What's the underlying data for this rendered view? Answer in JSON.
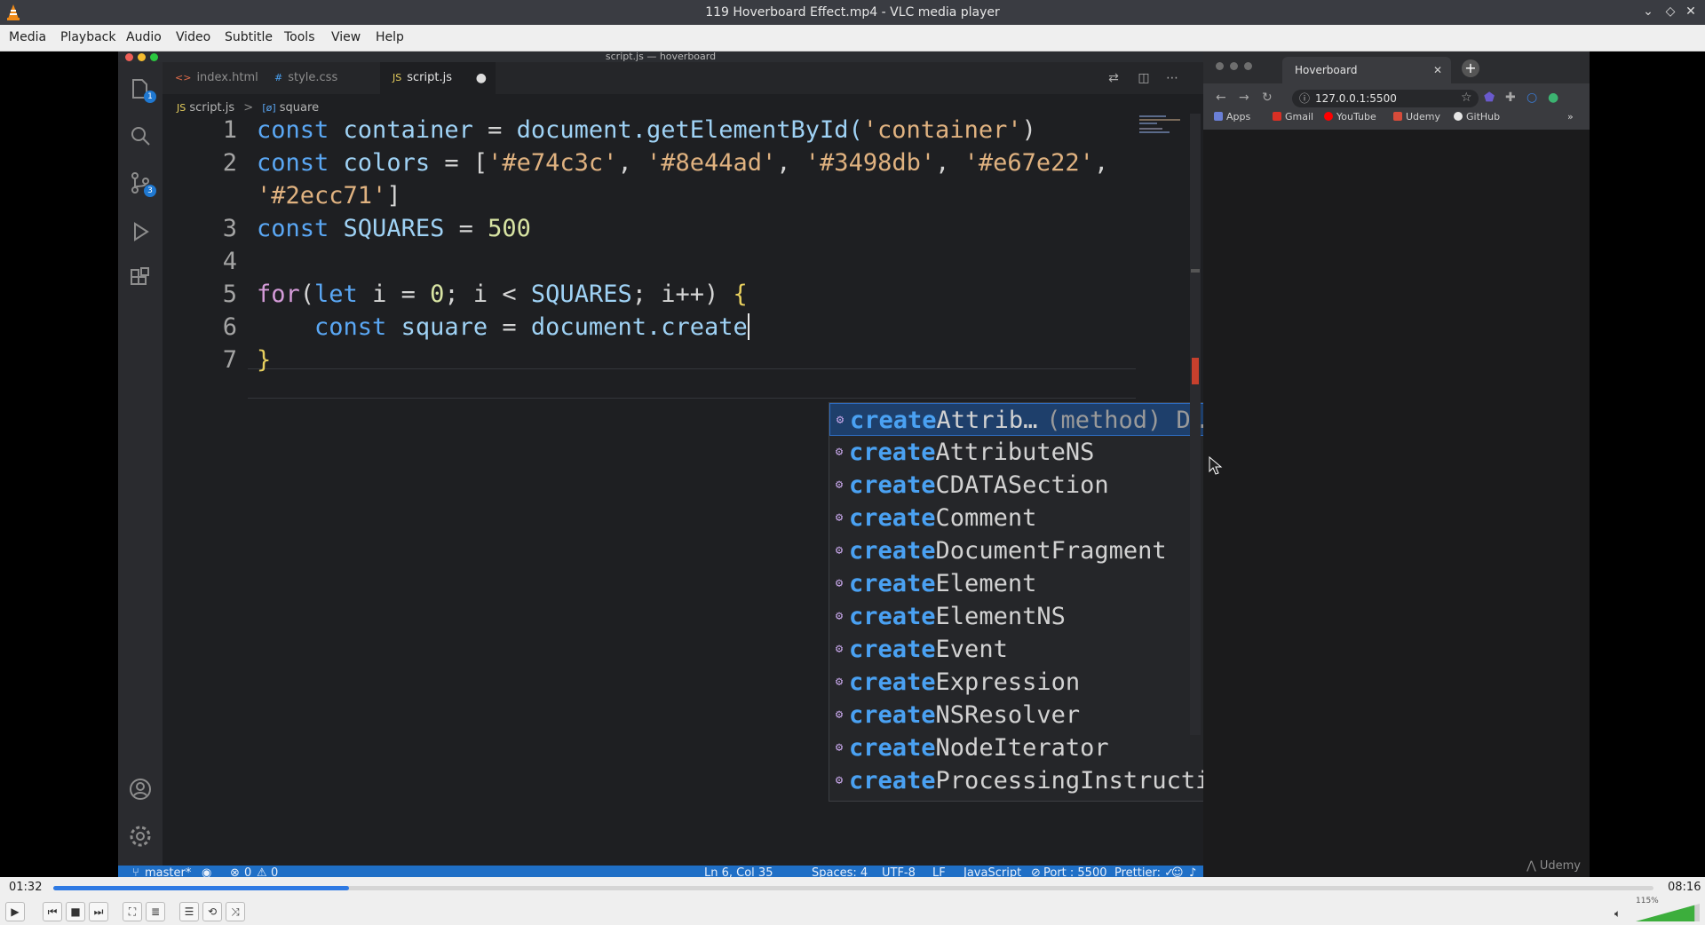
{
  "window": {
    "title": "119 Hoverboard Effect.mp4 - VLC media player",
    "buttons": [
      "chevron-down",
      "restore",
      "close"
    ]
  },
  "menu": [
    "Media",
    "Playback",
    "Audio",
    "Video",
    "Subtitle",
    "Tools",
    "View",
    "Help"
  ],
  "vscode": {
    "title": "script.js — hoverboard",
    "tabs": [
      {
        "tag": "<>",
        "label": "index.html"
      },
      {
        "tag": "#",
        "label": "style.css"
      },
      {
        "tag": "JS",
        "label": "script.js"
      }
    ],
    "breadcrumb": {
      "file": "script.js",
      "symbol": "square",
      "file_tag": "JS",
      "symbol_tag": "[ø]"
    },
    "activity_badges": {
      "explorer": "1",
      "scm": "3"
    },
    "line_numbers": [
      "1",
      "2",
      "",
      "3",
      "4",
      "5",
      "6",
      "7"
    ],
    "code": {
      "l1": {
        "kw": "const",
        "name": "container",
        "eq": " = ",
        "obj": "document.getElementById(",
        "arg": "'container'",
        "close": ")"
      },
      "l2": {
        "kw": "const",
        "name": "colors",
        "eq": " = ",
        "open": "[",
        "c1": "'#e74c3c'",
        "c2": "'#8e44ad'",
        "c3": "'#3498db'",
        "c4": "'#e67e22'",
        "comma": ", "
      },
      "l2b": {
        "c5": "'#2ecc71'",
        "close": "]"
      },
      "l3": {
        "kw": "const",
        "name": "SQUARES",
        "eq": " = ",
        "num": "500"
      },
      "l5": {
        "kw": "for",
        "open": "(",
        "let": "let",
        "body": " i = ",
        "zero": "0",
        "mid": "; i < ",
        "name": "SQUARES",
        "end": "; i++) ",
        "brace": "{"
      },
      "l6": {
        "kw": "const",
        "name": "square",
        "eq": " = ",
        "call": "document.create"
      },
      "l7": {
        "brace": "}"
      }
    },
    "suggestions": [
      {
        "match": "create",
        "rest": "Attrib…",
        "detail": "(method) D…"
      },
      {
        "match": "create",
        "rest": "AttributeNS"
      },
      {
        "match": "create",
        "rest": "CDATASection"
      },
      {
        "match": "create",
        "rest": "Comment"
      },
      {
        "match": "create",
        "rest": "DocumentFragment"
      },
      {
        "match": "create",
        "rest": "Element"
      },
      {
        "match": "create",
        "rest": "ElementNS"
      },
      {
        "match": "create",
        "rest": "Event"
      },
      {
        "match": "create",
        "rest": "Expression"
      },
      {
        "match": "create",
        "rest": "NSResolver"
      },
      {
        "match": "create",
        "rest": "NodeIterator"
      },
      {
        "match": "create",
        "rest": "ProcessingInstructi…"
      }
    ],
    "status": {
      "branch": "master*",
      "problems": "0",
      "warnings": "0",
      "position": "Ln 6, Col 35",
      "spaces": "Spaces: 4",
      "encoding": "UTF-8",
      "eol": "LF",
      "language": "JavaScript",
      "port": "Port : 5500",
      "prettier": "Prettier: ✓"
    }
  },
  "browser": {
    "tab_title": "Hoverboard",
    "url": "127.0.0.1:5500",
    "bookmarks": [
      "Apps",
      "Gmail",
      "YouTube",
      "Udemy",
      "GitHub"
    ],
    "watermark": "Udemy",
    "overflow": "»"
  },
  "player": {
    "elapsed": "01:32",
    "total": "08:16",
    "progress": 0.185,
    "volume_label": "115%",
    "volume": 1.15
  },
  "colors": {
    "accent": "#2f7ae3",
    "vscode_status": "#1f6fc6",
    "match": "#4aa1f2"
  }
}
